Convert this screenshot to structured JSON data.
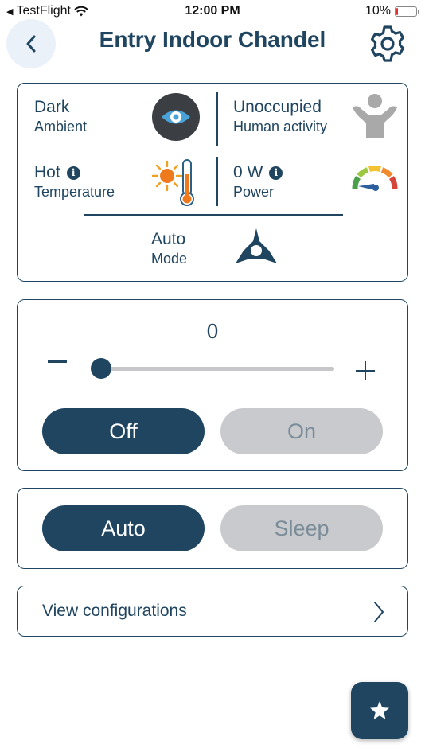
{
  "status_bar": {
    "back_app": "TestFlight",
    "time": "12:00 PM",
    "battery_text": "10%",
    "battery_level": 0.1
  },
  "header": {
    "title": "Entry Indoor Chandel",
    "back_icon": "chevron-left-icon",
    "settings_icon": "gear-icon"
  },
  "sensors": {
    "ambient": {
      "value": "Dark",
      "label": "Ambient",
      "icon": "eye-icon"
    },
    "human_activity": {
      "value": "Unoccupied",
      "label": "Human activity",
      "icon": "person-icon"
    },
    "temperature": {
      "value": "Hot",
      "label": "Temperature",
      "icon": "sun-thermometer-icon"
    },
    "power": {
      "value": "0 W",
      "label": "Power",
      "icon": "gauge-icon"
    },
    "mode": {
      "value": "Auto",
      "label": "Mode",
      "icon": "auto-mode-icon"
    }
  },
  "dimmer": {
    "value": "0",
    "level": 0,
    "off_label": "Off",
    "on_label": "On",
    "selected": "Off"
  },
  "mode_toggle": {
    "auto_label": "Auto",
    "sleep_label": "Sleep",
    "selected": "Auto"
  },
  "config": {
    "label": "View configurations"
  },
  "fab": {
    "icon": "star-icon"
  },
  "colors": {
    "primary": "#1f4560",
    "inactive": "#c9cacd",
    "inactive_text": "#7b8c99"
  }
}
